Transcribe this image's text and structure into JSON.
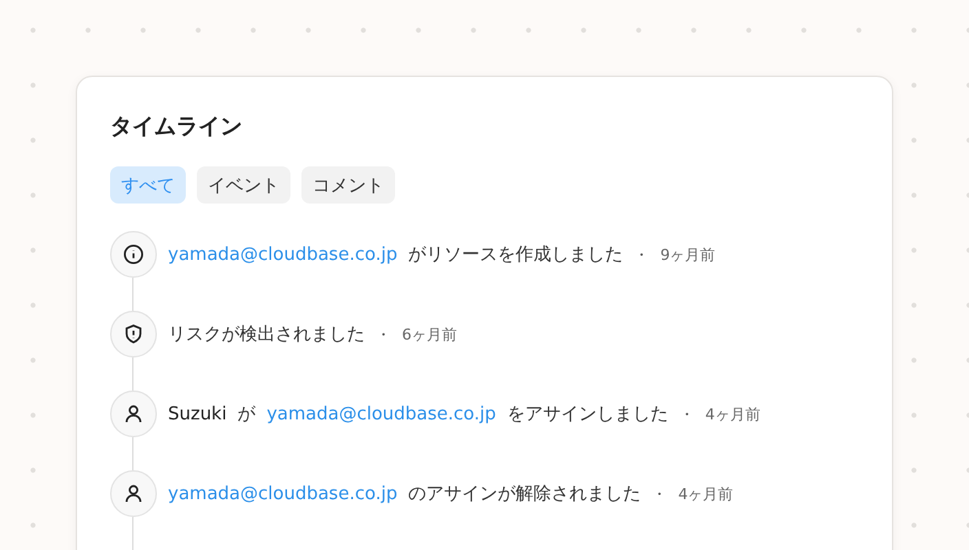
{
  "card": {
    "title": "タイムライン"
  },
  "tabs": [
    {
      "label": "すべて",
      "selected": true
    },
    {
      "label": "イベント",
      "selected": false
    },
    {
      "label": "コメント",
      "selected": false
    }
  ],
  "events": [
    {
      "kind": "created",
      "parts": [
        {
          "kind": "link",
          "text": "yamada@cloudbase.co.jp"
        },
        {
          "kind": "text",
          "text": "がリソースを作成しました"
        }
      ],
      "separator": "・",
      "time": "9ヶ月前"
    },
    {
      "kind": "risk",
      "parts": [
        {
          "kind": "text",
          "text": "リスクが検出されました"
        }
      ],
      "separator": "・",
      "time": "6ヶ月前"
    },
    {
      "kind": "assigned",
      "parts": [
        {
          "kind": "name",
          "text": "Suzuki"
        },
        {
          "kind": "text",
          "text": "が"
        },
        {
          "kind": "link",
          "text": "yamada@cloudbase.co.jp"
        },
        {
          "kind": "text",
          "text": "をアサインしました"
        }
      ],
      "separator": "・",
      "time": "4ヶ月前"
    },
    {
      "kind": "unassigned",
      "parts": [
        {
          "kind": "link",
          "text": "yamada@cloudbase.co.jp"
        },
        {
          "kind": "text",
          "text": "のアサインが解除されました"
        }
      ],
      "separator": "・",
      "time": "4ヶ月前"
    }
  ]
}
